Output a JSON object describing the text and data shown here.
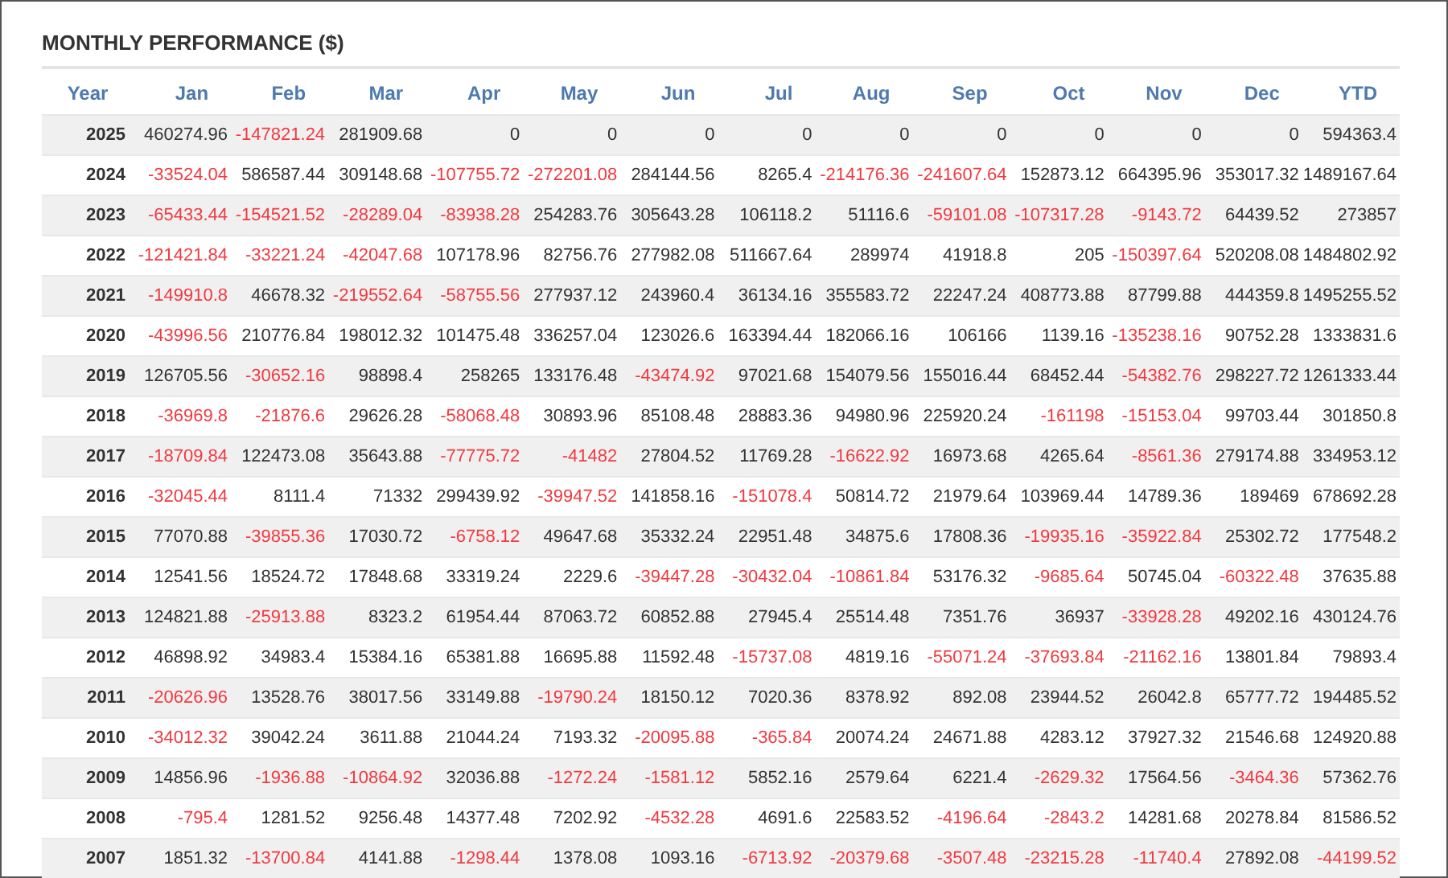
{
  "title": "MONTHLY PERFORMANCE ($)",
  "columns": [
    "Year",
    "Jan",
    "Feb",
    "Mar",
    "Apr",
    "May",
    "Jun",
    "Jul",
    "Aug",
    "Sep",
    "Oct",
    "Nov",
    "Dec",
    "YTD"
  ],
  "rows": [
    {
      "year": "2025",
      "cells": [
        {
          "text": "460274.96",
          "negative": false
        },
        {
          "text": "-147821.24",
          "negative": true
        },
        {
          "text": "281909.68",
          "negative": false
        },
        {
          "text": "0",
          "negative": false
        },
        {
          "text": "0",
          "negative": false
        },
        {
          "text": "0",
          "negative": false
        },
        {
          "text": "0",
          "negative": false
        },
        {
          "text": "0",
          "negative": false
        },
        {
          "text": "0",
          "negative": false
        },
        {
          "text": "0",
          "negative": false
        },
        {
          "text": "0",
          "negative": false
        },
        {
          "text": "0",
          "negative": false
        },
        {
          "text": "594363.4",
          "negative": false
        }
      ]
    },
    {
      "year": "2024",
      "cells": [
        {
          "text": "-33524.04",
          "negative": true
        },
        {
          "text": "586587.44",
          "negative": false
        },
        {
          "text": "309148.68",
          "negative": false
        },
        {
          "text": "-107755.72",
          "negative": true
        },
        {
          "text": "-272201.08",
          "negative": true
        },
        {
          "text": "284144.56",
          "negative": false
        },
        {
          "text": "8265.4",
          "negative": false
        },
        {
          "text": "-214176.36",
          "negative": true
        },
        {
          "text": "-241607.64",
          "negative": true
        },
        {
          "text": "152873.12",
          "negative": false
        },
        {
          "text": "664395.96",
          "negative": false
        },
        {
          "text": "353017.32",
          "negative": false
        },
        {
          "text": "1489167.64",
          "negative": false
        }
      ]
    },
    {
      "year": "2023",
      "cells": [
        {
          "text": "-65433.44",
          "negative": true
        },
        {
          "text": "-154521.52",
          "negative": true
        },
        {
          "text": "-28289.04",
          "negative": true
        },
        {
          "text": "-83938.28",
          "negative": true
        },
        {
          "text": "254283.76",
          "negative": false
        },
        {
          "text": "305643.28",
          "negative": false
        },
        {
          "text": "106118.2",
          "negative": false
        },
        {
          "text": "51116.6",
          "negative": false
        },
        {
          "text": "-59101.08",
          "negative": true
        },
        {
          "text": "-107317.28",
          "negative": true
        },
        {
          "text": "-9143.72",
          "negative": true
        },
        {
          "text": "64439.52",
          "negative": false
        },
        {
          "text": "273857",
          "negative": false
        }
      ]
    },
    {
      "year": "2022",
      "cells": [
        {
          "text": "-121421.84",
          "negative": true
        },
        {
          "text": "-33221.24",
          "negative": true
        },
        {
          "text": "-42047.68",
          "negative": true
        },
        {
          "text": "107178.96",
          "negative": false
        },
        {
          "text": "82756.76",
          "negative": false
        },
        {
          "text": "277982.08",
          "negative": false
        },
        {
          "text": "511667.64",
          "negative": false
        },
        {
          "text": "289974",
          "negative": false
        },
        {
          "text": "41918.8",
          "negative": false
        },
        {
          "text": "205",
          "negative": false
        },
        {
          "text": "-150397.64",
          "negative": true
        },
        {
          "text": "520208.08",
          "negative": false
        },
        {
          "text": "1484802.92",
          "negative": false
        }
      ]
    },
    {
      "year": "2021",
      "cells": [
        {
          "text": "-149910.8",
          "negative": true
        },
        {
          "text": "46678.32",
          "negative": false
        },
        {
          "text": "-219552.64",
          "negative": true
        },
        {
          "text": "-58755.56",
          "negative": true
        },
        {
          "text": "277937.12",
          "negative": false
        },
        {
          "text": "243960.4",
          "negative": false
        },
        {
          "text": "36134.16",
          "negative": false
        },
        {
          "text": "355583.72",
          "negative": false
        },
        {
          "text": "22247.24",
          "negative": false
        },
        {
          "text": "408773.88",
          "negative": false
        },
        {
          "text": "87799.88",
          "negative": false
        },
        {
          "text": "444359.8",
          "negative": false
        },
        {
          "text": "1495255.52",
          "negative": false
        }
      ]
    },
    {
      "year": "2020",
      "cells": [
        {
          "text": "-43996.56",
          "negative": true
        },
        {
          "text": "210776.84",
          "negative": false
        },
        {
          "text": "198012.32",
          "negative": false
        },
        {
          "text": "101475.48",
          "negative": false
        },
        {
          "text": "336257.04",
          "negative": false
        },
        {
          "text": "123026.6",
          "negative": false
        },
        {
          "text": "163394.44",
          "negative": false
        },
        {
          "text": "182066.16",
          "negative": false
        },
        {
          "text": "106166",
          "negative": false
        },
        {
          "text": "1139.16",
          "negative": false
        },
        {
          "text": "-135238.16",
          "negative": true
        },
        {
          "text": "90752.28",
          "negative": false
        },
        {
          "text": "1333831.6",
          "negative": false
        }
      ]
    },
    {
      "year": "2019",
      "cells": [
        {
          "text": "126705.56",
          "negative": false
        },
        {
          "text": "-30652.16",
          "negative": true
        },
        {
          "text": "98898.4",
          "negative": false
        },
        {
          "text": "258265",
          "negative": false
        },
        {
          "text": "133176.48",
          "negative": false
        },
        {
          "text": "-43474.92",
          "negative": true
        },
        {
          "text": "97021.68",
          "negative": false
        },
        {
          "text": "154079.56",
          "negative": false
        },
        {
          "text": "155016.44",
          "negative": false
        },
        {
          "text": "68452.44",
          "negative": false
        },
        {
          "text": "-54382.76",
          "negative": true
        },
        {
          "text": "298227.72",
          "negative": false
        },
        {
          "text": "1261333.44",
          "negative": false
        }
      ]
    },
    {
      "year": "2018",
      "cells": [
        {
          "text": "-36969.8",
          "negative": true
        },
        {
          "text": "-21876.6",
          "negative": true
        },
        {
          "text": "29626.28",
          "negative": false
        },
        {
          "text": "-58068.48",
          "negative": true
        },
        {
          "text": "30893.96",
          "negative": false
        },
        {
          "text": "85108.48",
          "negative": false
        },
        {
          "text": "28883.36",
          "negative": false
        },
        {
          "text": "94980.96",
          "negative": false
        },
        {
          "text": "225920.24",
          "negative": false
        },
        {
          "text": "-161198",
          "negative": true
        },
        {
          "text": "-15153.04",
          "negative": true
        },
        {
          "text": "99703.44",
          "negative": false
        },
        {
          "text": "301850.8",
          "negative": false
        }
      ]
    },
    {
      "year": "2017",
      "cells": [
        {
          "text": "-18709.84",
          "negative": true
        },
        {
          "text": "122473.08",
          "negative": false
        },
        {
          "text": "35643.88",
          "negative": false
        },
        {
          "text": "-77775.72",
          "negative": true
        },
        {
          "text": "-41482",
          "negative": true
        },
        {
          "text": "27804.52",
          "negative": false
        },
        {
          "text": "11769.28",
          "negative": false
        },
        {
          "text": "-16622.92",
          "negative": true
        },
        {
          "text": "16973.68",
          "negative": false
        },
        {
          "text": "4265.64",
          "negative": false
        },
        {
          "text": "-8561.36",
          "negative": true
        },
        {
          "text": "279174.88",
          "negative": false
        },
        {
          "text": "334953.12",
          "negative": false
        }
      ]
    },
    {
      "year": "2016",
      "cells": [
        {
          "text": "-32045.44",
          "negative": true
        },
        {
          "text": "8111.4",
          "negative": false
        },
        {
          "text": "71332",
          "negative": false
        },
        {
          "text": "299439.92",
          "negative": false
        },
        {
          "text": "-39947.52",
          "negative": true
        },
        {
          "text": "141858.16",
          "negative": false
        },
        {
          "text": "-151078.4",
          "negative": true
        },
        {
          "text": "50814.72",
          "negative": false
        },
        {
          "text": "21979.64",
          "negative": false
        },
        {
          "text": "103969.44",
          "negative": false
        },
        {
          "text": "14789.36",
          "negative": false
        },
        {
          "text": "189469",
          "negative": false
        },
        {
          "text": "678692.28",
          "negative": false
        }
      ]
    },
    {
      "year": "2015",
      "cells": [
        {
          "text": "77070.88",
          "negative": false
        },
        {
          "text": "-39855.36",
          "negative": true
        },
        {
          "text": "17030.72",
          "negative": false
        },
        {
          "text": "-6758.12",
          "negative": true
        },
        {
          "text": "49647.68",
          "negative": false
        },
        {
          "text": "35332.24",
          "negative": false
        },
        {
          "text": "22951.48",
          "negative": false
        },
        {
          "text": "34875.6",
          "negative": false
        },
        {
          "text": "17808.36",
          "negative": false
        },
        {
          "text": "-19935.16",
          "negative": true
        },
        {
          "text": "-35922.84",
          "negative": true
        },
        {
          "text": "25302.72",
          "negative": false
        },
        {
          "text": "177548.2",
          "negative": false
        }
      ]
    },
    {
      "year": "2014",
      "cells": [
        {
          "text": "12541.56",
          "negative": false
        },
        {
          "text": "18524.72",
          "negative": false
        },
        {
          "text": "17848.68",
          "negative": false
        },
        {
          "text": "33319.24",
          "negative": false
        },
        {
          "text": "2229.6",
          "negative": false
        },
        {
          "text": "-39447.28",
          "negative": true
        },
        {
          "text": "-30432.04",
          "negative": true
        },
        {
          "text": "-10861.84",
          "negative": true
        },
        {
          "text": "53176.32",
          "negative": false
        },
        {
          "text": "-9685.64",
          "negative": true
        },
        {
          "text": "50745.04",
          "negative": false
        },
        {
          "text": "-60322.48",
          "negative": true
        },
        {
          "text": "37635.88",
          "negative": false
        }
      ]
    },
    {
      "year": "2013",
      "cells": [
        {
          "text": "124821.88",
          "negative": false
        },
        {
          "text": "-25913.88",
          "negative": true
        },
        {
          "text": "8323.2",
          "negative": false
        },
        {
          "text": "61954.44",
          "negative": false
        },
        {
          "text": "87063.72",
          "negative": false
        },
        {
          "text": "60852.88",
          "negative": false
        },
        {
          "text": "27945.4",
          "negative": false
        },
        {
          "text": "25514.48",
          "negative": false
        },
        {
          "text": "7351.76",
          "negative": false
        },
        {
          "text": "36937",
          "negative": false
        },
        {
          "text": "-33928.28",
          "negative": true
        },
        {
          "text": "49202.16",
          "negative": false
        },
        {
          "text": "430124.76",
          "negative": false
        }
      ]
    },
    {
      "year": "2012",
      "cells": [
        {
          "text": "46898.92",
          "negative": false
        },
        {
          "text": "34983.4",
          "negative": false
        },
        {
          "text": "15384.16",
          "negative": false
        },
        {
          "text": "65381.88",
          "negative": false
        },
        {
          "text": "16695.88",
          "negative": false
        },
        {
          "text": "11592.48",
          "negative": false
        },
        {
          "text": "-15737.08",
          "negative": true
        },
        {
          "text": "4819.16",
          "negative": false
        },
        {
          "text": "-55071.24",
          "negative": true
        },
        {
          "text": "-37693.84",
          "negative": true
        },
        {
          "text": "-21162.16",
          "negative": true
        },
        {
          "text": "13801.84",
          "negative": false
        },
        {
          "text": "79893.4",
          "negative": false
        }
      ]
    },
    {
      "year": "2011",
      "cells": [
        {
          "text": "-20626.96",
          "negative": true
        },
        {
          "text": "13528.76",
          "negative": false
        },
        {
          "text": "38017.56",
          "negative": false
        },
        {
          "text": "33149.88",
          "negative": false
        },
        {
          "text": "-19790.24",
          "negative": true
        },
        {
          "text": "18150.12",
          "negative": false
        },
        {
          "text": "7020.36",
          "negative": false
        },
        {
          "text": "8378.92",
          "negative": false
        },
        {
          "text": "892.08",
          "negative": false
        },
        {
          "text": "23944.52",
          "negative": false
        },
        {
          "text": "26042.8",
          "negative": false
        },
        {
          "text": "65777.72",
          "negative": false
        },
        {
          "text": "194485.52",
          "negative": false
        }
      ]
    },
    {
      "year": "2010",
      "cells": [
        {
          "text": "-34012.32",
          "negative": true
        },
        {
          "text": "39042.24",
          "negative": false
        },
        {
          "text": "3611.88",
          "negative": false
        },
        {
          "text": "21044.24",
          "negative": false
        },
        {
          "text": "7193.32",
          "negative": false
        },
        {
          "text": "-20095.88",
          "negative": true
        },
        {
          "text": "-365.84",
          "negative": true
        },
        {
          "text": "20074.24",
          "negative": false
        },
        {
          "text": "24671.88",
          "negative": false
        },
        {
          "text": "4283.12",
          "negative": false
        },
        {
          "text": "37927.32",
          "negative": false
        },
        {
          "text": "21546.68",
          "negative": false
        },
        {
          "text": "124920.88",
          "negative": false
        }
      ]
    },
    {
      "year": "2009",
      "cells": [
        {
          "text": "14856.96",
          "negative": false
        },
        {
          "text": "-1936.88",
          "negative": true
        },
        {
          "text": "-10864.92",
          "negative": true
        },
        {
          "text": "32036.88",
          "negative": false
        },
        {
          "text": "-1272.24",
          "negative": true
        },
        {
          "text": "-1581.12",
          "negative": true
        },
        {
          "text": "5852.16",
          "negative": false
        },
        {
          "text": "2579.64",
          "negative": false
        },
        {
          "text": "6221.4",
          "negative": false
        },
        {
          "text": "-2629.32",
          "negative": true
        },
        {
          "text": "17564.56",
          "negative": false
        },
        {
          "text": "-3464.36",
          "negative": true
        },
        {
          "text": "57362.76",
          "negative": false
        }
      ]
    },
    {
      "year": "2008",
      "cells": [
        {
          "text": "-795.4",
          "negative": true
        },
        {
          "text": "1281.52",
          "negative": false
        },
        {
          "text": "9256.48",
          "negative": false
        },
        {
          "text": "14377.48",
          "negative": false
        },
        {
          "text": "7202.92",
          "negative": false
        },
        {
          "text": "-4532.28",
          "negative": true
        },
        {
          "text": "4691.6",
          "negative": false
        },
        {
          "text": "22583.52",
          "negative": false
        },
        {
          "text": "-4196.64",
          "negative": true
        },
        {
          "text": "-2843.2",
          "negative": true
        },
        {
          "text": "14281.68",
          "negative": false
        },
        {
          "text": "20278.84",
          "negative": false
        },
        {
          "text": "81586.52",
          "negative": false
        }
      ]
    },
    {
      "year": "2007",
      "cells": [
        {
          "text": "1851.32",
          "negative": false
        },
        {
          "text": "-13700.84",
          "negative": true
        },
        {
          "text": "4141.88",
          "negative": false
        },
        {
          "text": "-1298.44",
          "negative": true
        },
        {
          "text": "1378.08",
          "negative": false
        },
        {
          "text": "1093.16",
          "negative": false
        },
        {
          "text": "-6713.92",
          "negative": true
        },
        {
          "text": "-20379.68",
          "negative": true
        },
        {
          "text": "-3507.48",
          "negative": true
        },
        {
          "text": "-23215.28",
          "negative": true
        },
        {
          "text": "-11740.4",
          "negative": true
        },
        {
          "text": "27892.08",
          "negative": false
        },
        {
          "text": "-44199.52",
          "negative": true
        }
      ]
    }
  ]
}
